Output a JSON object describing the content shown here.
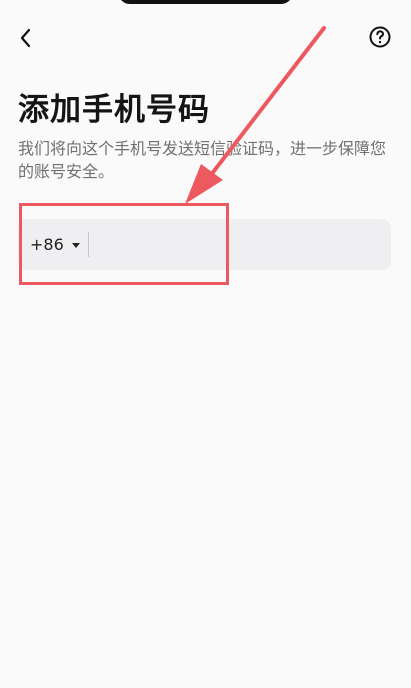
{
  "header": {
    "back_icon": "chevron-left-icon",
    "help_icon": "question-circle-icon"
  },
  "page": {
    "title": "添加手机号码",
    "description": "我们将向这个手机号发送短信验证码，进一步保障您的账号安全。"
  },
  "phone_input": {
    "country_code": "+86",
    "dropdown_icon": "caret-down-icon",
    "value": "",
    "placeholder": ""
  },
  "annotation": {
    "arrow_icon": "arrow-icon",
    "highlight_color": "#ec5a5f"
  },
  "colors": {
    "background": "#fbfafb",
    "input_background": "#efeef0",
    "accent": "#ec5a5f"
  }
}
